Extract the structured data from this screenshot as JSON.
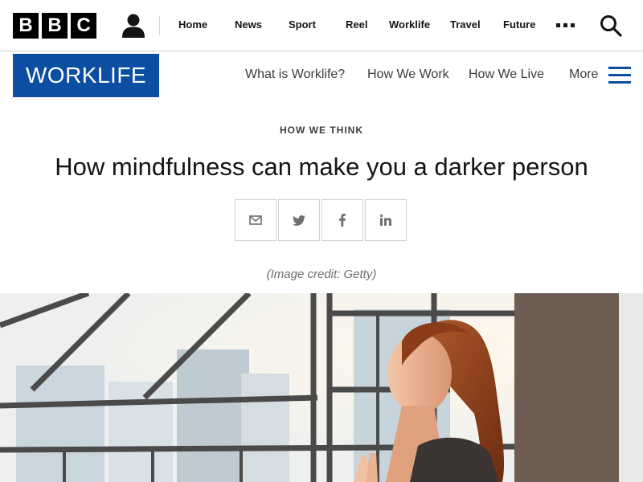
{
  "brand": {
    "letters": [
      "B",
      "B",
      "C"
    ]
  },
  "global_nav": {
    "items": [
      {
        "label": "Home"
      },
      {
        "label": "News"
      },
      {
        "label": "Sport"
      },
      {
        "label": "Reel"
      },
      {
        "label": "Worklife"
      },
      {
        "label": "Travel"
      },
      {
        "label": "Future"
      }
    ],
    "more_icon": "more-dots-icon",
    "search_icon": "search-icon",
    "account_icon": "account-icon"
  },
  "section": {
    "logo_text": "WORKLIFE",
    "logo_color": "#0b4ea2",
    "nav": [
      {
        "label": "What is Worklife?"
      },
      {
        "label": "How We Work"
      },
      {
        "label": "How We Live"
      }
    ],
    "more_label": "More",
    "menu_icon": "hamburger-menu-icon"
  },
  "article": {
    "category": "HOW WE THINK",
    "headline": "How mindfulness can make you a darker person",
    "share": [
      {
        "icon": "email-icon"
      },
      {
        "icon": "twitter-icon"
      },
      {
        "icon": "facebook-icon"
      },
      {
        "icon": "linkedin-icon"
      }
    ],
    "image_credit": "(Image credit: Getty)"
  },
  "colors": {
    "accent": "#0b4ea2",
    "text": "#141414",
    "muted": "#6e6e73",
    "border": "#d5d0cd"
  }
}
